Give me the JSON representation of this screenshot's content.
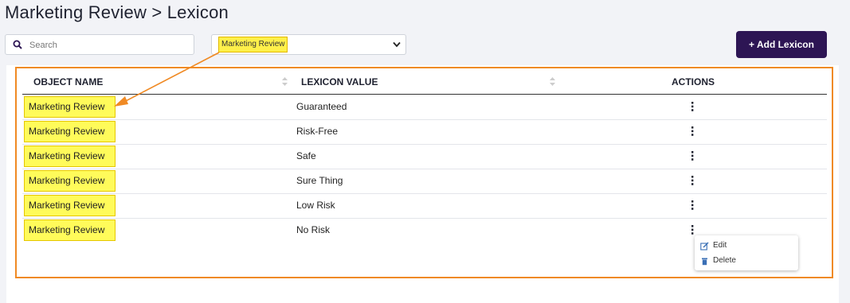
{
  "page": {
    "title": "Marketing Review > Lexicon"
  },
  "search": {
    "placeholder": "Search",
    "icon": "search-icon"
  },
  "filter": {
    "selected": "Marketing Review",
    "icon": "chevron-down-icon"
  },
  "toolbar": {
    "add_label": "+ Add Lexicon"
  },
  "table": {
    "columns": [
      "OBJECT NAME",
      "LEXICON VALUE",
      "ACTIONS"
    ],
    "rows": [
      {
        "object_name": "Marketing Review",
        "lexicon_value": "Guaranteed"
      },
      {
        "object_name": "Marketing Review",
        "lexicon_value": "Risk-Free"
      },
      {
        "object_name": "Marketing Review",
        "lexicon_value": "Safe"
      },
      {
        "object_name": "Marketing Review",
        "lexicon_value": "Sure Thing"
      },
      {
        "object_name": "Marketing Review",
        "lexicon_value": "Low Risk"
      },
      {
        "object_name": "Marketing Review",
        "lexicon_value": "No Risk"
      }
    ]
  },
  "action_menu": {
    "edit_label": "Edit",
    "delete_label": "Delete"
  },
  "colors": {
    "accent": "#2d1554",
    "highlight": "#fffb5a",
    "annotation": "#f08a24"
  }
}
